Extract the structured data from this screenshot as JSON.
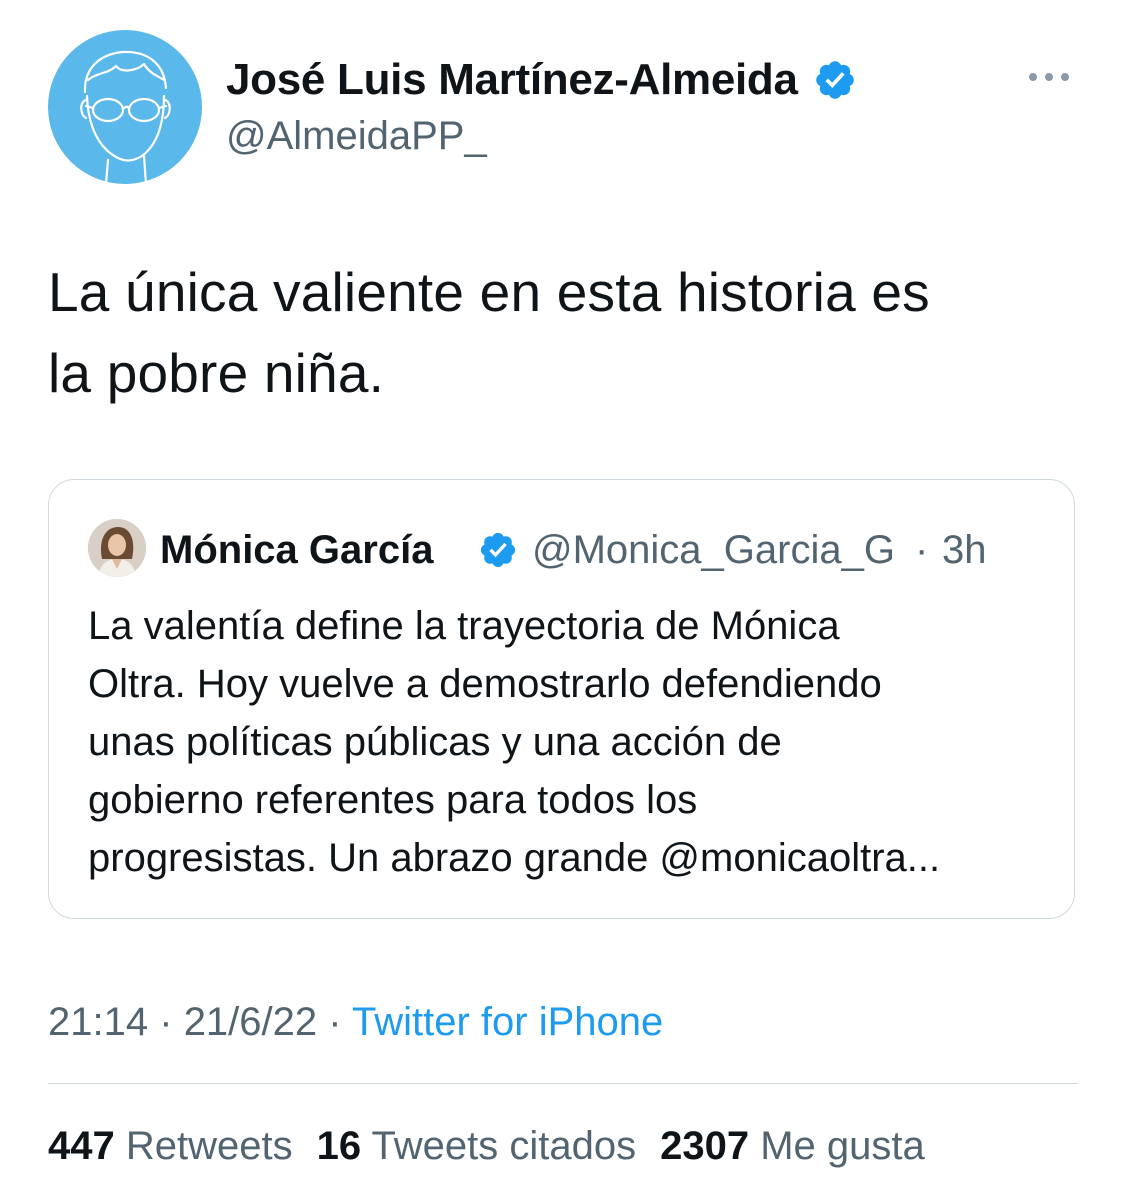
{
  "author": {
    "display_name": "José Luis Martínez-Almeida",
    "handle": "@AlmeidaPP_",
    "verified": true,
    "avatar_icon": "cartoon-face-with-glasses-avatar",
    "avatar_bg": "#5bb8ea"
  },
  "tweet": {
    "text_line1": "La única valiente en esta historia es",
    "text_line2": "la pobre niña."
  },
  "quoted_tweet": {
    "display_name": "Mónica García",
    "handle": "@Monica_Garcia_G",
    "separator": "·",
    "time": "3h",
    "verified": true,
    "lines": [
      "La valentía define la trayectoria de Mónica",
      "Oltra. Hoy vuelve a demostrarlo defendiendo",
      "unas políticas públicas y una acción de",
      "gobierno referentes para todos los",
      "progresistas. Un abrazo grande @monicaoltra..."
    ]
  },
  "meta": {
    "time": "21:14",
    "date": "21/6/22",
    "separator": "·",
    "source": "Twitter for iPhone"
  },
  "stats": {
    "retweets_count": "447",
    "retweets_label": "Retweets",
    "quotes_count": "16",
    "quotes_label": "Tweets citados",
    "likes_count": "2307",
    "likes_label": "Me gusta"
  },
  "colors": {
    "accent": "#1d9bf0",
    "secondary_text": "#536471",
    "border": "#cfd9de"
  }
}
